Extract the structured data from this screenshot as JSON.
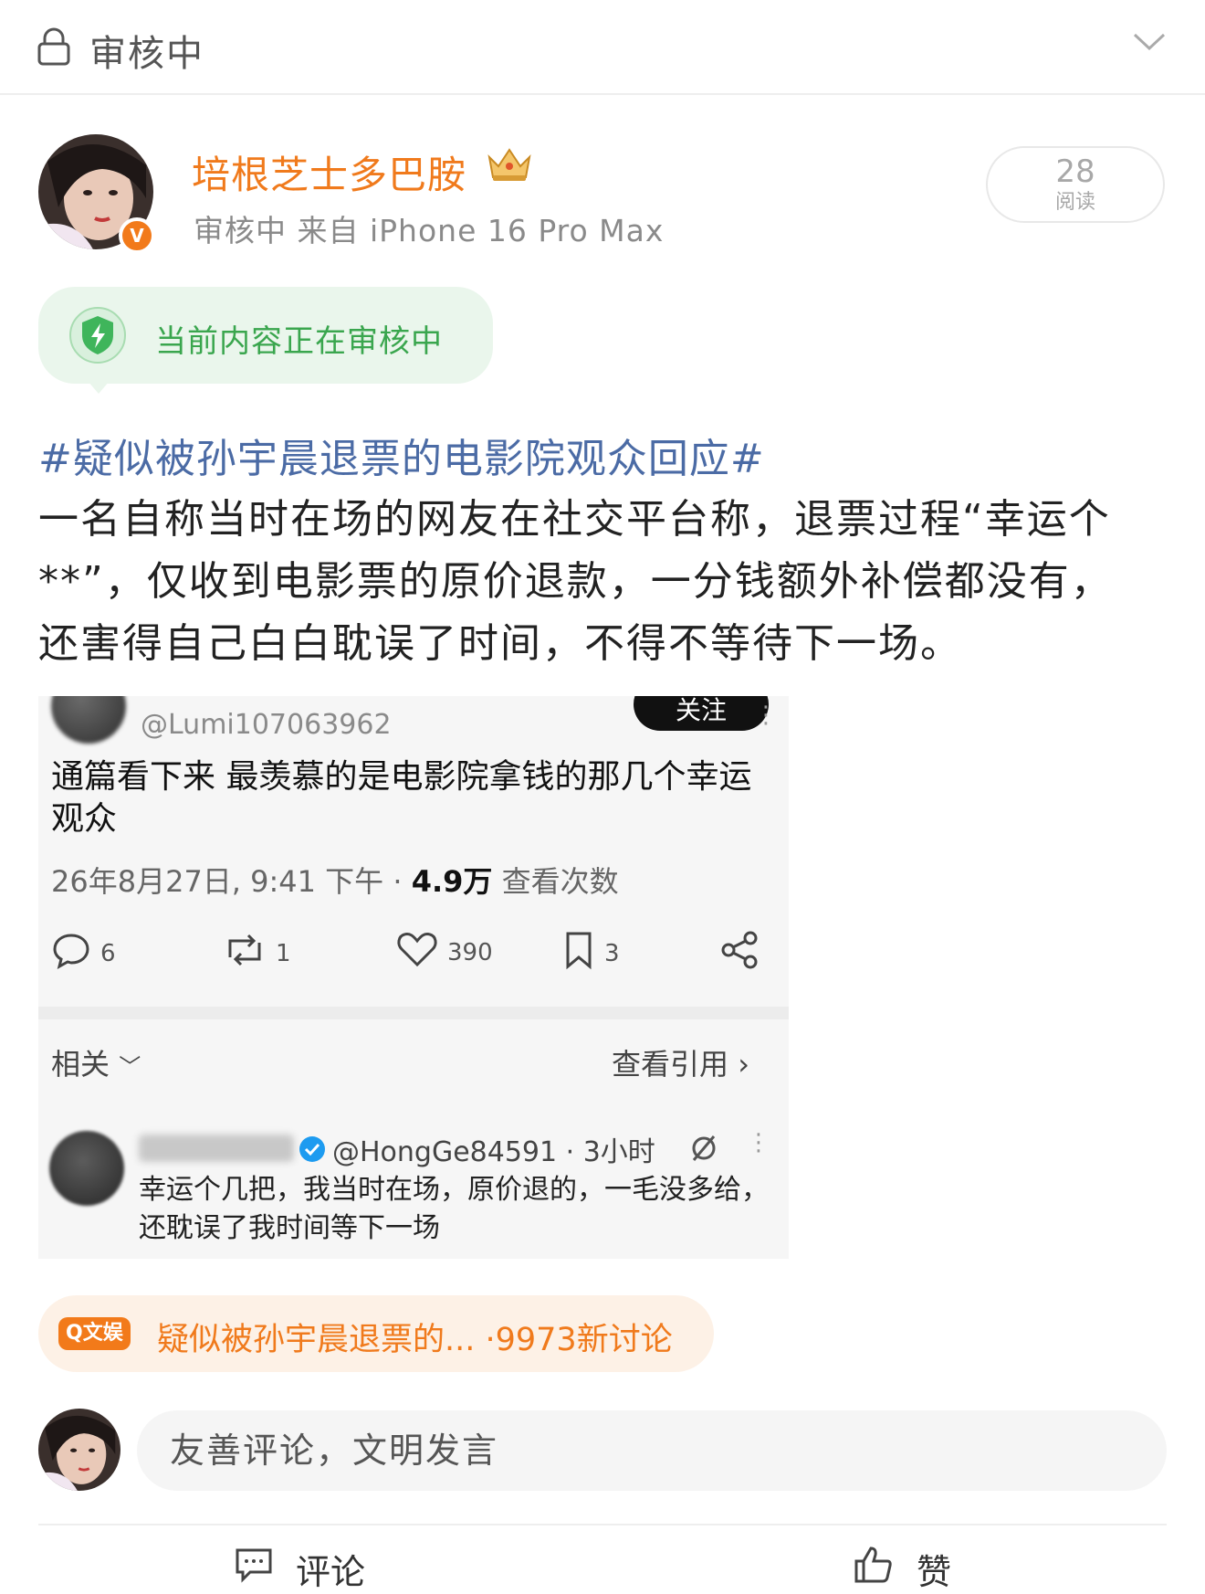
{
  "topbar": {
    "title": "审核中",
    "lock_icon": "lock-icon",
    "collapse_icon": "chevron-down-icon"
  },
  "author": {
    "name": "培根芝士多巴胺",
    "meta": "审核中 来自 iPhone 16 Pro Max",
    "verified_badge": "V",
    "crown_icon": "crown-icon"
  },
  "reads": {
    "count": "28",
    "label": "阅读"
  },
  "review_banner": {
    "text": "当前内容正在审核中",
    "icon": "shield-check-icon"
  },
  "post": {
    "hashtag": "#疑似被孙宇晨退票的电影院观众回应#",
    "lines": [
      "一名自称当时在场的网友在社交平台称，退票过程“幸运个",
      "**”，仅收到电影票的原价退款，一分钱额外补偿都没有，",
      "还害得自己白白耽误了时间，不得不等待下一场。"
    ]
  },
  "embedded": {
    "handle": "@Lumi107063962",
    "follow_label": "关注",
    "tweet_text": "通篇看下来 最羡慕的是电影院拿钱的那几个幸运观众",
    "timestamp": "26年8月27日, 9:41 下午 · ",
    "views_count": "4.9万",
    "views_label": " 查看次数",
    "actions": {
      "reply_count": "6",
      "retweet_count": "1",
      "like_count": "390",
      "bookmark_count": "3"
    },
    "related_label": "相关",
    "view_quotes_label": "查看引用",
    "reply": {
      "handle": "@HongGe84591 · 3小时",
      "text": "幸运个几把，我当时在场，原价退的，一毛没多给，还耽误了我时间等下一场"
    }
  },
  "topic": {
    "tag": "Q文娱",
    "text": "疑似被孙宇晨退票的... ·9973新讨论"
  },
  "comment_input": {
    "placeholder": "友善评论，文明发言"
  },
  "bottom_bar": {
    "comment_label": "评论",
    "like_label": "赞"
  },
  "colors": {
    "brand_orange": "#f07a1c",
    "review_green": "#3aa64e",
    "hashtag_blue": "#4b6ba5"
  }
}
